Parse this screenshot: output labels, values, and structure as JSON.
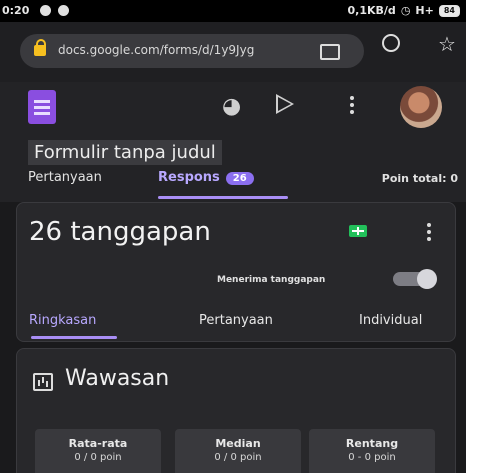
{
  "status_bar": {
    "time": "0:20",
    "network": "0,1KB/d",
    "signal": "H+",
    "battery": "84"
  },
  "browser": {
    "url": "docs.google.com/forms/d/1y9Jyg"
  },
  "header": {
    "form_title": "Formulir tanpa judul",
    "tabs": [
      {
        "label": "Pertanyaan"
      },
      {
        "label": "Respons",
        "badge": "26"
      }
    ],
    "total_points": "Poin total: 0"
  },
  "responses": {
    "title": "26 tanggapan",
    "accepting_label": "Menerima tanggapan",
    "accepting": true,
    "sub_tabs": [
      "Ringkasan",
      "Pertanyaan",
      "Individual"
    ],
    "active_sub_tab": "Ringkasan"
  },
  "insights": {
    "title": "Wawasan",
    "stats": [
      {
        "label": "Rata-rata",
        "value": "0 / 0 poin"
      },
      {
        "label": "Median",
        "value": "0 / 0 poin"
      },
      {
        "label": "Rentang",
        "value": "0 - 0 poin"
      }
    ]
  },
  "colors": {
    "accent": "#a98ef5",
    "background": "#1a1a1c",
    "sheets": "#22c05a",
    "forms_logo": "#8a4ee0"
  },
  "icons": [
    "lock-icon",
    "tabs-icon",
    "reload-icon",
    "star-icon",
    "forms-logo-icon",
    "palette-icon",
    "send-icon",
    "more-icon",
    "avatar",
    "sheets-icon",
    "insights-icon"
  ]
}
